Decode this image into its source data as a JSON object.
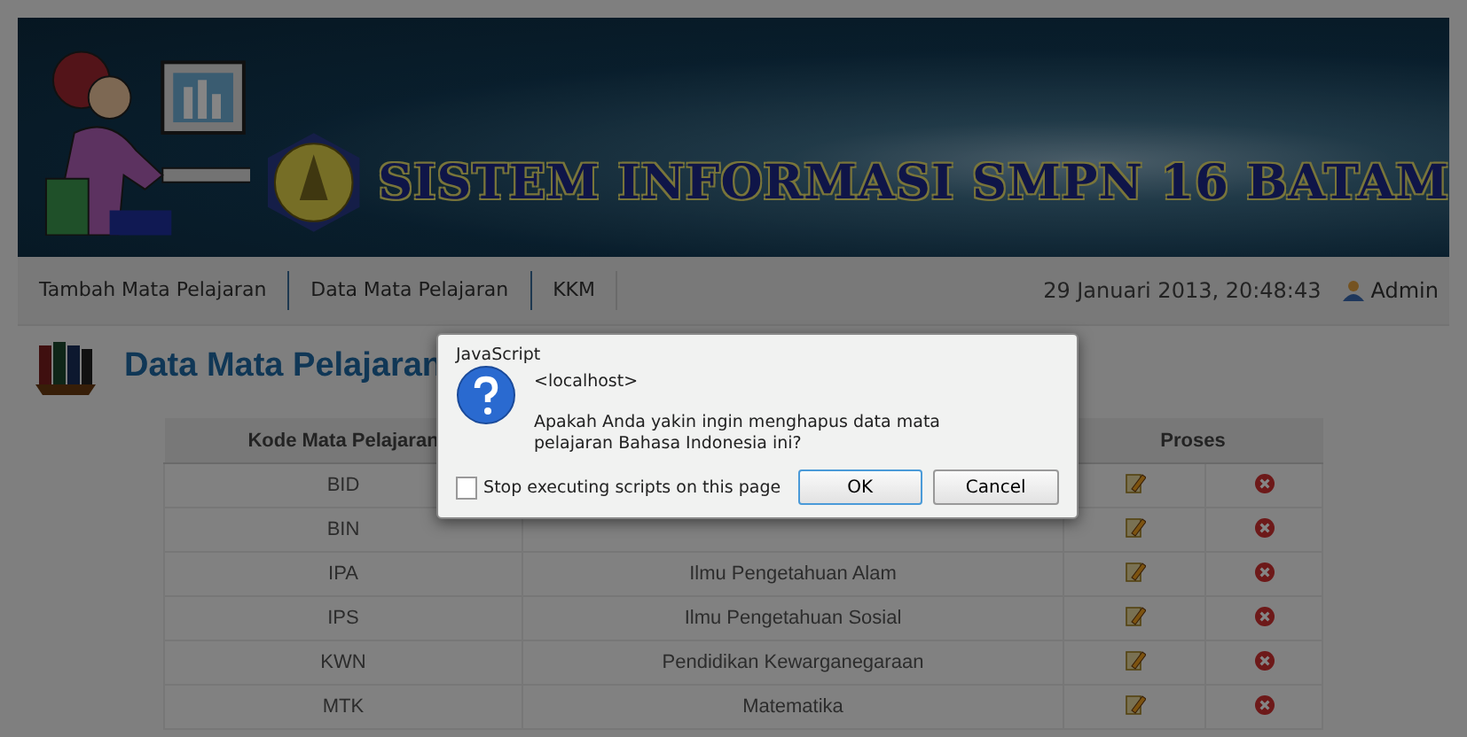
{
  "banner": {
    "title": "SISTEM INFORMASI SMPN 16 BATAM"
  },
  "nav": {
    "items": [
      "Tambah Mata Pelajaran",
      "Data Mata Pelajaran",
      "KKM"
    ],
    "datetime": "29 Januari 2013, 20:48:43",
    "user": "Admin"
  },
  "page_title": "Data Mata Pelajaran",
  "table": {
    "columns": [
      "Kode Mata Pelajaran",
      "Proses"
    ],
    "rows": [
      {
        "code": "BID"
      },
      {
        "code": "BIN"
      },
      {
        "code": "IPA",
        "name": "Ilmu Pengetahuan Alam"
      },
      {
        "code": "IPS",
        "name": "Ilmu Pengetahuan Sosial"
      },
      {
        "code": "KWN",
        "name": "Pendidikan Kewarganegaraan"
      },
      {
        "code": "MTK",
        "name": "Matematika"
      }
    ]
  },
  "dialog": {
    "title": "JavaScript",
    "origin": "<localhost>",
    "message": "Apakah Anda yakin ingin menghapus data mata pelajaran Bahasa Indonesia ini?",
    "checkbox": {
      "label": "Stop executing scripts on this page",
      "checked": false
    },
    "buttons": [
      "OK",
      "Cancel"
    ]
  }
}
